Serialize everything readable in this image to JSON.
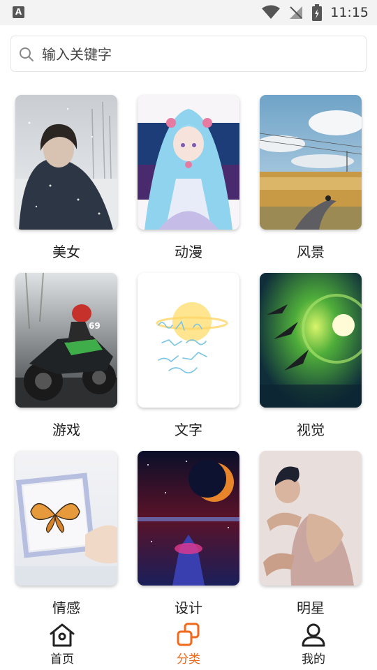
{
  "status_bar": {
    "time": "11:15",
    "left_badge": "A"
  },
  "search": {
    "placeholder": "输入关键字"
  },
  "categories": [
    {
      "label": "美女"
    },
    {
      "label": "动漫"
    },
    {
      "label": "风景"
    },
    {
      "label": "游戏"
    },
    {
      "label": "文字"
    },
    {
      "label": "视觉"
    },
    {
      "label": "情感"
    },
    {
      "label": "设计"
    },
    {
      "label": "明星"
    }
  ],
  "tab_bar": {
    "active_color": "#f06a1d",
    "items": [
      {
        "label": "首页",
        "icon": "home-icon"
      },
      {
        "label": "分类",
        "icon": "category-icon"
      },
      {
        "label": "我的",
        "icon": "profile-icon"
      }
    ]
  }
}
